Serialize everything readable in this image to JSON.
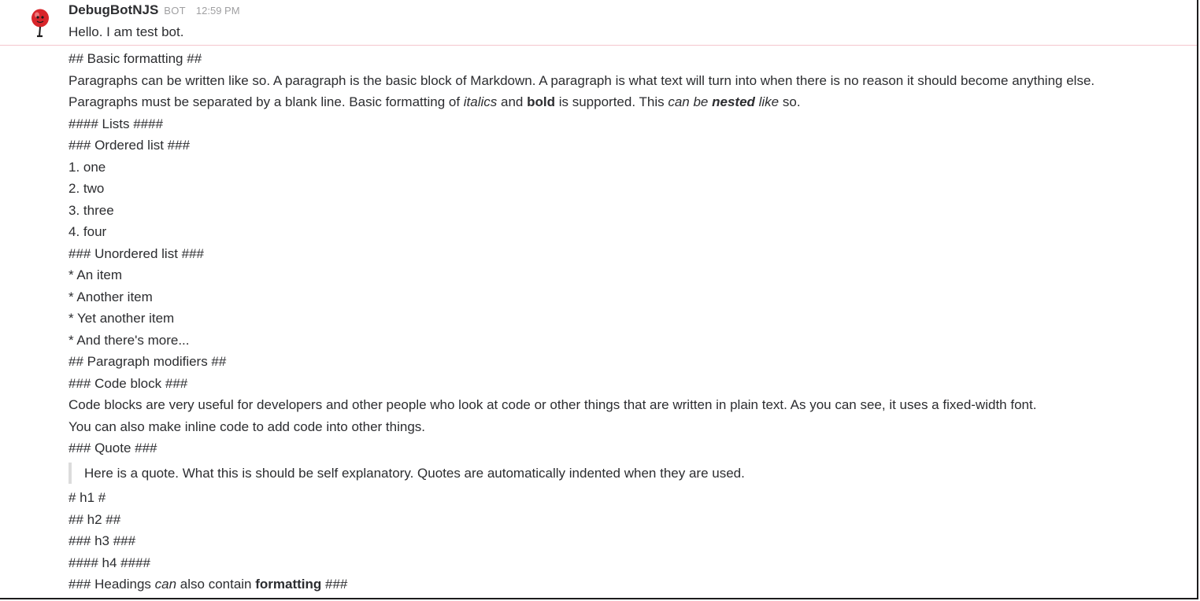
{
  "message": {
    "author": "DebugBotNJS",
    "badge": "BOT",
    "time": "12:59 PM",
    "greeting": "Hello. I am test bot."
  },
  "content": {
    "basic_heading": "## Basic formatting ##",
    "para_line1": "Paragraphs can be written like so. A paragraph is the  basic block of Markdown.  A paragraph is what text will turn  into when there is no reason it should become anything else.",
    "para_line2": {
      "part1": "Paragraphs must be separated by a blank line. Basic formatting of ",
      "italics": "italics",
      "part2": " and ",
      "bold": "bold",
      "part3": " is supported. This ",
      "can_be": "can be",
      "space": " ",
      "nested": "nested",
      "like": " like",
      "part4": " so."
    },
    "lists_heading": "#### Lists ####",
    "ordered_heading": "### Ordered list ###",
    "ordered_items": [
      "1. one",
      "2. two",
      "3. three",
      "4. four"
    ],
    "unordered_heading": "### Unordered list ###",
    "unordered_items": [
      "* An item",
      "* Another item",
      "* Yet another item",
      "* And there's more..."
    ],
    "modifiers_heading": "## Paragraph modifiers ##",
    "code_heading": "### Code block ###",
    "code_line1": "Code blocks are very useful for developers and other  people who look at code or other things that are written  in plain text. As you can see, it uses a fixed-width font.",
    "code_line2": "You can also make inline code to add code into other things.",
    "quote_heading": "### Quote ###",
    "quote_text": "Here is a quote. What this is should be self explanatory.  Quotes are automatically indented when they are used.",
    "h1": "# h1 #",
    "h2": "## h2 ##",
    "h3": "### h3 ###",
    "h4": "#### h4 ####",
    "last_heading": {
      "part1": "### Headings ",
      "can": "can",
      "part2": " also contain ",
      "formatting": "formatting",
      "part3": " ###"
    }
  },
  "colors": {
    "text": "#2c2d30",
    "muted": "#a0a0a2",
    "divider": "#f5c6cd",
    "quote_bar": "#dcdcdc",
    "avatar_red": "#d8262b"
  }
}
